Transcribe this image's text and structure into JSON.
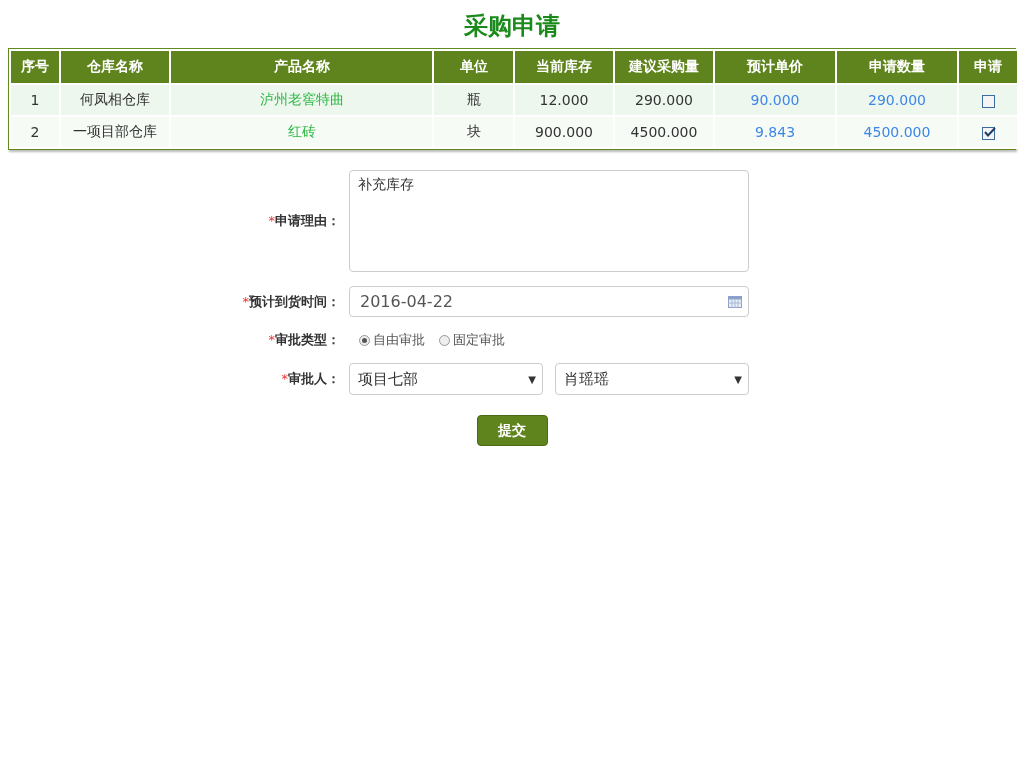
{
  "title": "采购申请",
  "table": {
    "columns": [
      "序号",
      "仓库名称",
      "产品名称",
      "单位",
      "当前库存",
      "建议采购量",
      "预计单价",
      "申请数量",
      "申请"
    ],
    "rows": [
      {
        "cells": [
          "1",
          "何凤相仓库",
          "泸州老窖特曲",
          "瓶",
          "12.000",
          "290.000",
          "90.000",
          "290.000"
        ],
        "checked": false
      },
      {
        "cells": [
          "2",
          "一项目部仓库",
          "红砖",
          "块",
          "900.000",
          "4500.000",
          "9.843",
          "4500.000"
        ],
        "checked": true
      }
    ]
  },
  "form": {
    "reason": {
      "required_mark": "*",
      "label": "申请理由：",
      "value": "补充库存"
    },
    "arrival": {
      "required_mark": "*",
      "label": "预计到货时间：",
      "value": "2016-04-22"
    },
    "approval_type": {
      "required_mark": "*",
      "label": "审批类型：",
      "options": [
        {
          "label": "自由审批",
          "selected": true
        },
        {
          "label": "固定审批",
          "selected": false
        }
      ]
    },
    "approver": {
      "required_mark": "*",
      "label": "审批人：",
      "selects": [
        {
          "value": "项目七部",
          "caret": "▼"
        },
        {
          "value": "肖瑶瑶",
          "caret": "▼"
        }
      ]
    }
  },
  "submit": "提交"
}
